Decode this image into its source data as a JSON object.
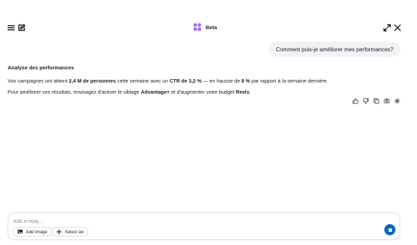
{
  "header": {
    "brand_name": "Beta",
    "icons": [
      "menu-icon",
      "compose-icon",
      "brand-logo-icon",
      "expand-icon",
      "close-icon"
    ]
  },
  "conversation": {
    "user_message": "Comment puis-je améliorer mes performances?",
    "reply": {
      "title": "Analyse des performances",
      "p1": {
        "t1": "Vos campagnes ont atteint ",
        "b1": "2,4 M de personnes",
        "t2": " cette semaine avec un ",
        "b2": "CTR de 3,2 %",
        "t3": " — en hausse de ",
        "b3": "8 %",
        "t4": " par rapport à la semaine dernière."
      },
      "p2": {
        "t1": "Pour améliorer vos résultats, envisagez d'activer le ciblage ",
        "b1": "Advantage+",
        "t2": " et d'augmenter votre budget ",
        "b2": "Reels",
        "t3": "."
      }
    },
    "action_icons": [
      "thumbs-up-icon",
      "thumbs-down-icon",
      "copy-icon",
      "share-icon",
      "sparkle-icon"
    ]
  },
  "composer": {
    "placeholder": "Add a reply...",
    "value": "",
    "add_image_label": "Add image",
    "select_ad_label": "Select ad",
    "send_icon": "stop-icon"
  },
  "colors": {
    "accent": "#0a66c2",
    "bubble_bg": "#f0f2f5",
    "border": "#dadde1",
    "brand_gradient": [
      "#7b61ff",
      "#c069ff"
    ]
  }
}
